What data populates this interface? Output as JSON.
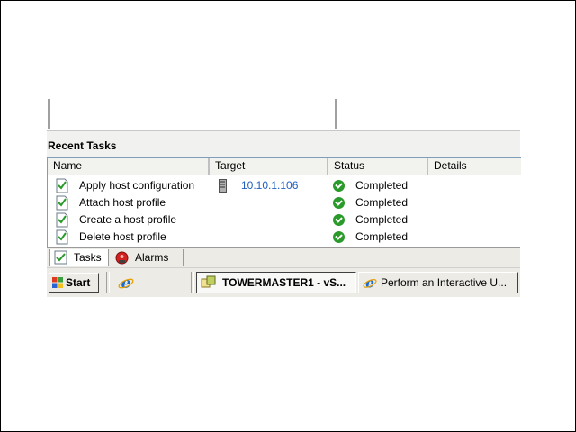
{
  "panel": {
    "title": "Recent Tasks",
    "columns": [
      "Name",
      "Target",
      "Status",
      "Details"
    ],
    "rows": [
      {
        "name": "Apply host configuration",
        "target": "10.10.1.106",
        "status": "Completed",
        "details": ""
      },
      {
        "name": "Attach host profile",
        "target": "",
        "status": "Completed",
        "details": ""
      },
      {
        "name": "Create a host profile",
        "target": "",
        "status": "Completed",
        "details": ""
      },
      {
        "name": "Delete host profile",
        "target": "",
        "status": "Completed",
        "details": ""
      }
    ]
  },
  "tabs": [
    {
      "label": "Tasks",
      "icon": "tasks-icon",
      "active": true
    },
    {
      "label": "Alarms",
      "icon": "alarm-icon",
      "active": false
    }
  ],
  "taskbar": {
    "start_label": "Start",
    "quicklaunch_icon": "internet-explorer-icon",
    "buttons": [
      {
        "label": "TOWERMASTER1 - vS...",
        "icon": "vsphere-client-icon",
        "pressed": true
      },
      {
        "label": "Perform an Interactive U...",
        "icon": "internet-explorer-icon",
        "pressed": false
      }
    ]
  },
  "colors": {
    "link": "#2060c0",
    "status_ok": "#2a9a2a",
    "panel_bg": "#f1f1ef",
    "taskbar_bg": "#ecebe6"
  }
}
